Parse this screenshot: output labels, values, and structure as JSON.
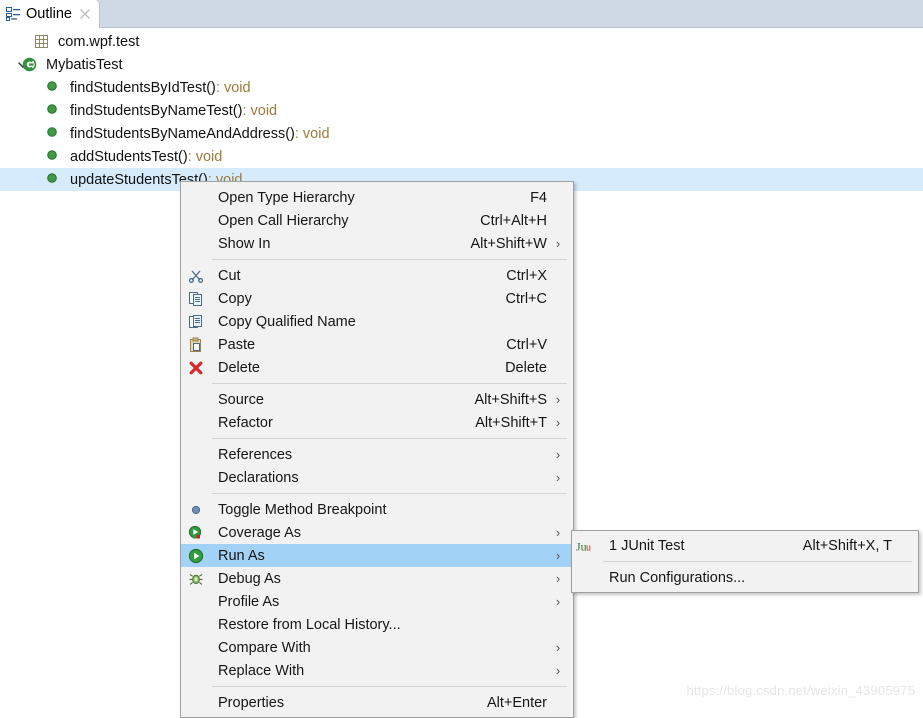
{
  "view": {
    "tab": {
      "label": "Outline",
      "icon": "outline-icon",
      "close_icon": "close-icon"
    }
  },
  "tree": {
    "items": [
      {
        "label": "com.wpf.test",
        "type": "",
        "icon": "package-icon",
        "indent": 1,
        "expander": "none",
        "selected": false
      },
      {
        "label": "MybatisTest",
        "type": "",
        "icon": "class-icon",
        "indent": 0,
        "expander": "expanded",
        "selected": false
      },
      {
        "label": "findStudentsByIdTest()",
        "type": " : void",
        "icon": "method-icon",
        "indent": 2,
        "expander": "none",
        "selected": false
      },
      {
        "label": "findStudentsByNameTest()",
        "type": " : void",
        "icon": "method-icon",
        "indent": 2,
        "expander": "none",
        "selected": false
      },
      {
        "label": "findStudentsByNameAndAddress()",
        "type": " : void",
        "icon": "method-icon",
        "indent": 2,
        "expander": "none",
        "selected": false
      },
      {
        "label": "addStudentsTest()",
        "type": " : void",
        "icon": "method-icon",
        "indent": 2,
        "expander": "none",
        "selected": false
      },
      {
        "label": "updateStudentsTest()",
        "type": " : void",
        "icon": "method-icon",
        "indent": 2,
        "expander": "none",
        "selected": true
      }
    ]
  },
  "context_menu": {
    "items": [
      {
        "label": "Open Type Hierarchy",
        "accel": "F4",
        "icon": "",
        "arrow": false,
        "selected": false
      },
      {
        "label": "Open Call Hierarchy",
        "accel": "Ctrl+Alt+H",
        "icon": "",
        "arrow": false,
        "selected": false
      },
      {
        "label": "Show In",
        "accel": "Alt+Shift+W",
        "icon": "",
        "arrow": true,
        "selected": false
      },
      {
        "separator": true
      },
      {
        "label": "Cut",
        "accel": "Ctrl+X",
        "icon": "scissors-icon",
        "arrow": false,
        "selected": false
      },
      {
        "label": "Copy",
        "accel": "Ctrl+C",
        "icon": "copy-icon",
        "arrow": false,
        "selected": false
      },
      {
        "label": "Copy Qualified Name",
        "accel": "",
        "icon": "copy-qualified-icon",
        "arrow": false,
        "selected": false
      },
      {
        "label": "Paste",
        "accel": "Ctrl+V",
        "icon": "clipboard-icon",
        "arrow": false,
        "selected": false
      },
      {
        "label": "Delete",
        "accel": "Delete",
        "icon": "delete-x-icon",
        "arrow": false,
        "selected": false
      },
      {
        "separator": true
      },
      {
        "label": "Source",
        "accel": "Alt+Shift+S",
        "icon": "",
        "arrow": true,
        "selected": false
      },
      {
        "label": "Refactor",
        "accel": "Alt+Shift+T",
        "icon": "",
        "arrow": true,
        "selected": false
      },
      {
        "separator": true
      },
      {
        "label": "References",
        "accel": "",
        "icon": "",
        "arrow": true,
        "selected": false
      },
      {
        "label": "Declarations",
        "accel": "",
        "icon": "",
        "arrow": true,
        "selected": false
      },
      {
        "separator": true
      },
      {
        "label": "Toggle Method Breakpoint",
        "accel": "",
        "icon": "breakpoint-icon",
        "arrow": false,
        "selected": false
      },
      {
        "label": "Coverage As",
        "accel": "",
        "icon": "coverage-icon",
        "arrow": true,
        "selected": false
      },
      {
        "label": "Run As",
        "accel": "",
        "icon": "run-icon",
        "arrow": true,
        "selected": true
      },
      {
        "label": "Debug As",
        "accel": "",
        "icon": "debug-bug-icon",
        "arrow": true,
        "selected": false
      },
      {
        "label": "Profile As",
        "accel": "",
        "icon": "",
        "arrow": true,
        "selected": false
      },
      {
        "label": "Restore from Local History...",
        "accel": "",
        "icon": "",
        "arrow": false,
        "selected": false
      },
      {
        "label": "Compare With",
        "accel": "",
        "icon": "",
        "arrow": true,
        "selected": false
      },
      {
        "label": "Replace With",
        "accel": "",
        "icon": "",
        "arrow": true,
        "selected": false
      },
      {
        "separator": true
      },
      {
        "label": "Properties",
        "accel": "Alt+Enter",
        "icon": "",
        "arrow": false,
        "selected": false
      }
    ]
  },
  "submenu": {
    "items": [
      {
        "label": "1 JUnit Test",
        "accel": "Alt+Shift+X, T",
        "icon": "junit-icon",
        "arrow": false,
        "selected": false
      },
      {
        "separator": true
      },
      {
        "label": "Run Configurations...",
        "accel": "",
        "icon": "",
        "arrow": false,
        "selected": false
      }
    ]
  },
  "watermark": {
    "text": "https://blog.csdn.net/weixin_43905975"
  },
  "colors": {
    "menu_bg": "#f2f2f2",
    "menu_border": "#a0a0a0",
    "highlight": "#a2d2f5",
    "tree_selection": "#d6ebfb",
    "tabbar_bg": "#cfd9e5",
    "accent_green": "#3f9c45",
    "type_text": "#9c7a3c"
  }
}
